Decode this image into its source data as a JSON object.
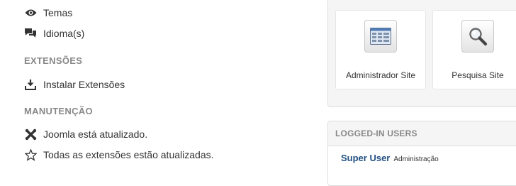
{
  "menu": {
    "temas_label": "Temas",
    "idioma_label": "Idioma(s)",
    "extensoes_heading": "EXTENSÕES",
    "instalar_label": "Instalar Extensões",
    "manutencao_heading": "MANUTENÇÃO",
    "joomla_status_label": "Joomla está atualizado.",
    "extensions_status_label": "Todas as extensões estão atualizadas."
  },
  "quick_icons": [
    {
      "label": "Administrador Site",
      "icon": "window-panel-icon"
    },
    {
      "label": "Pesquisa Site",
      "icon": "magnifier-icon"
    }
  ],
  "logged_users": {
    "heading": "LOGGED-IN USERS",
    "user_name": "Super User",
    "user_role": "Administração"
  },
  "colors": {
    "link_blue": "#205081",
    "heading_gray": "#888888"
  }
}
